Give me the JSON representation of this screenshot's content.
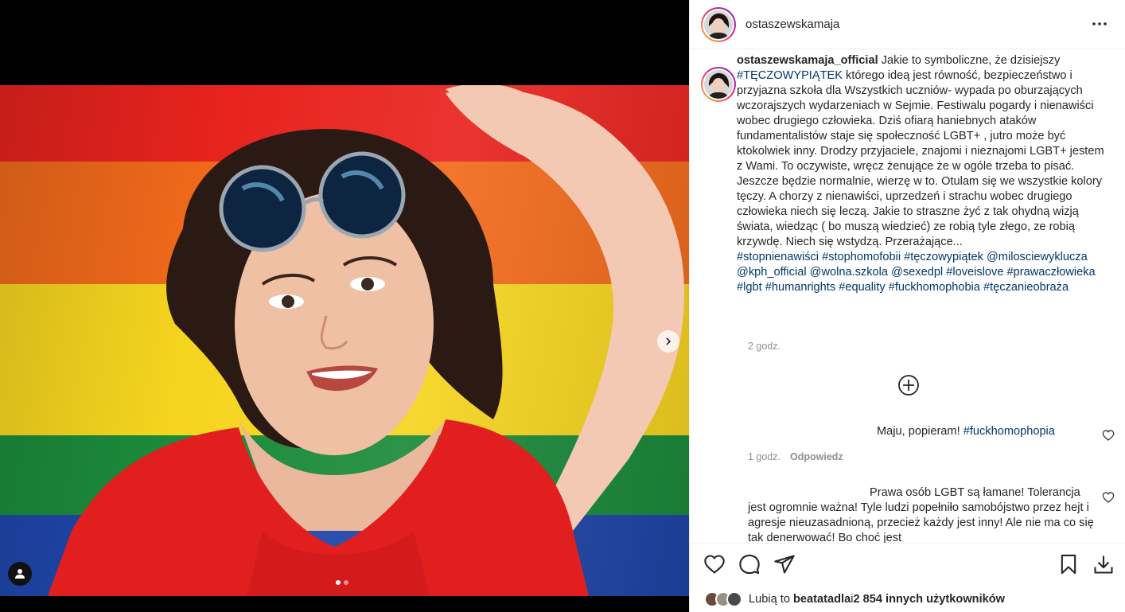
{
  "post": {
    "username": "ostaszewskamaja",
    "more_icon": "ellipsis-icon"
  },
  "caption": {
    "username": "ostaszewskamaja_official",
    "text_1": " Jakie to symboliczne, że dzisiejszy ",
    "hashtag_1": "#TĘCZOWYPIĄTEK",
    "text_2": " którego ideą jest równość, bezpieczeństwo i przyjazna szkoła dla Wszystkich uczniów- wypada po oburzających wczorajszych wydarzeniach w Sejmie. Festiwalu pogardy i nienawiści wobec drugiego człowieka. Dziś ofiarą haniebnych ataków fundamentalistów staje się społeczność LGBT+ , jutro może być ktokolwiek inny. Drodzy przyjaciele, znajomi i nieznajomi LGBT+ jestem z Wami. To oczywiste, wręcz żenujące że w ogóle trzeba to pisać. Jeszcze będzie normalnie, wierzę w to. Otulam się we wszystkie kolory tęczy. A chorzy z nienawiści, uprzedzeń i strachu wobec drugiego człowieka niech się leczą. Jakie to straszne żyć z tak ohydną wizją świata, wiedząc ( bo muszą wiedzieć) ze robią tyle złego, ze robią krzywdę. Niech się wstydzą. Przerażające...",
    "tags": [
      "#stopnienawiści",
      "#stophomofobii",
      "#tęczowypiątek",
      "@milosciewyklucza",
      "@kph_official",
      "@wolna.szkola",
      "@sexedpl",
      "#loveislove",
      "#prawaczłowieka",
      "#lgbt",
      "#humanrights",
      "#equality",
      "#fuckhomophobia",
      "#tęczanieobraża"
    ],
    "time": "2 godz."
  },
  "comments": [
    {
      "text_plain": "Maju, popieram! ",
      "text_tag": "#fuckhomophopia",
      "time": "1 godz.",
      "reply_label": "Odpowiedz"
    },
    {
      "text_plain": "Prawa osób LGBT są łamane! Tolerancja jest ogromnie ważna! Tyle ludzi popełniło samobójstwo przez hejt i agresje nieuzasadnioną, przecież każdy jest inny! Ale nie ma co się tak denerwować! Bo choć jest"
    }
  ],
  "likes": {
    "prefix": "Lubią to ",
    "first_user": "beatatadla",
    "joiner": " i ",
    "others": "2 854 innych użytkowników"
  },
  "colors": {
    "link": "#00376b",
    "muted": "#8e8e8e",
    "flag": [
      "#e8231e",
      "#f26a1b",
      "#f6d51f",
      "#1b8a3a",
      "#1e45a8"
    ]
  },
  "media": {
    "carousel_current": 1,
    "carousel_total": 2
  }
}
